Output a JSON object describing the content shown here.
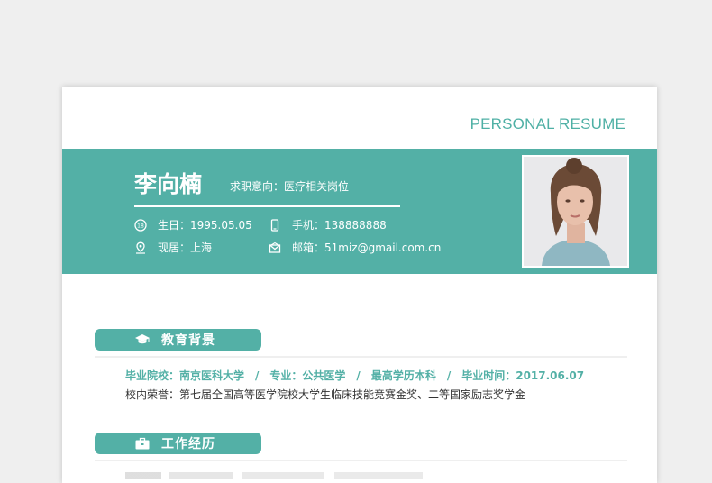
{
  "header": {
    "title": "PERSONAL RESUME"
  },
  "profile": {
    "name": "李向楠",
    "intent": "求职意向：医疗相关岗位",
    "birthday": "生日：1995.05.05",
    "phone": "手机：138888888",
    "residence": "现居：上海",
    "email": "邮箱：51miz@gmail.com.cn"
  },
  "sections": {
    "education": {
      "label": "教育背景",
      "icon": "graduation-cap-icon",
      "details": {
        "school": "毕业院校：南京医科大学",
        "major": "专业：公共医学",
        "degree": "最高学历本科",
        "graduation": "毕业时间：2017.06.07",
        "separator": "/"
      },
      "honors": "校内荣誉：第七届全国高等医学院校大学生临床技能竞赛金奖、二等国家励志奖学金"
    },
    "work": {
      "label": "工作经历",
      "icon": "briefcase-icon"
    }
  },
  "colors": {
    "accent": "#53b0a6",
    "background": "#efefef",
    "text": "#333333"
  }
}
